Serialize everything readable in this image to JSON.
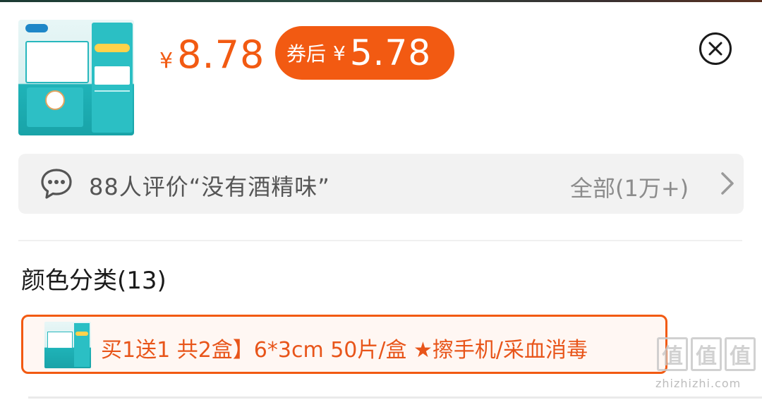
{
  "product": {
    "thumbnail_icon": "product-photo",
    "price_currency": "¥",
    "price": "8.78",
    "coupon_label": "券后",
    "coupon_currency": "¥",
    "coupon_price": "5.78"
  },
  "close_icon": "close-circle-icon",
  "reviews": {
    "icon": "chat-bubble-icon",
    "summary": "88人评价“没有酒精味”",
    "all_label": "全部(1万+)",
    "chevron_icon": "chevron-right-icon"
  },
  "sku_section": {
    "title": "颜色分类(13)",
    "selected_option": {
      "label": "买1送1 共2盒】6*3cm 50片/盒 ★擦手机/采血消毒"
    }
  },
  "watermark": {
    "glyph": "值",
    "text": "zhizhizhi.com"
  },
  "colors": {
    "accent": "#f25a12",
    "review_bg": "#f2f2f2"
  }
}
